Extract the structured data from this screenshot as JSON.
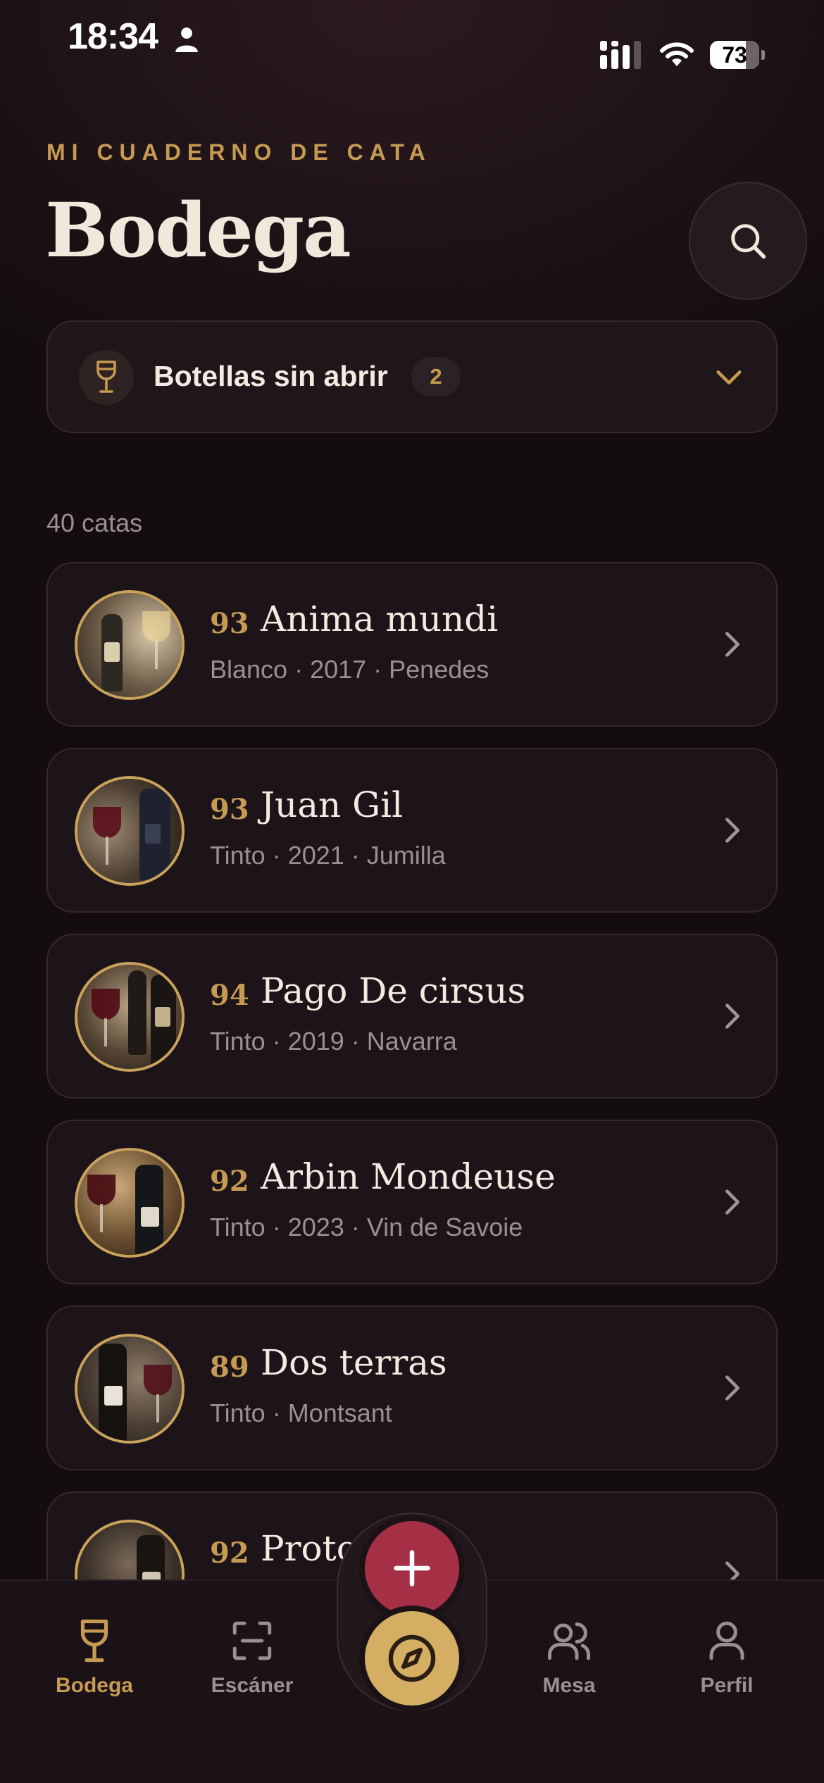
{
  "status_bar": {
    "time": "18:34",
    "battery_level": "73",
    "battery_fraction": 0.73,
    "icons": [
      "person-icon",
      "signal-icon",
      "wifi-icon",
      "battery-icon"
    ]
  },
  "header": {
    "eyebrow": "MI CUADERNO DE CATA",
    "title": "Bodega",
    "search_icon": "search-icon"
  },
  "unopened": {
    "label": "Botellas sin abrir",
    "count": "2",
    "icon": "wine-glass-icon",
    "expanded": false
  },
  "tastings_count": "40 catas",
  "tastings": [
    {
      "score": "93",
      "name": "Anima mundi",
      "meta": "Blanco · 2017 · Penedes"
    },
    {
      "score": "93",
      "name": "Juan Gil",
      "meta": "Tinto · 2021 · Jumilla"
    },
    {
      "score": "94",
      "name": "Pago De cirsus",
      "meta": "Tinto · 2019 · Navarra"
    },
    {
      "score": "92",
      "name": "Arbin Mondeuse",
      "meta": "Tinto · 2023 · Vin de Savoie"
    },
    {
      "score": "89",
      "name": "Dos terras",
      "meta": "Tinto · Montsant"
    },
    {
      "score": "92",
      "name": "Proto",
      "meta": ""
    }
  ],
  "tabbar": {
    "tabs": [
      {
        "label": "Bodega",
        "icon": "wine-glass-icon",
        "active": true
      },
      {
        "label": "Escáner",
        "icon": "scan-icon",
        "active": false
      },
      {
        "label": "Mesa",
        "icon": "users-icon",
        "active": false
      },
      {
        "label": "Perfil",
        "icon": "user-icon",
        "active": false
      }
    ],
    "add_icon": "plus-icon",
    "explore_icon": "compass-icon"
  },
  "colors": {
    "background": "#130d0f",
    "accent_gold": "#c69a52",
    "add_button": "#a52f44",
    "explore_button": "#d4ae62",
    "card": "#1c1418"
  }
}
